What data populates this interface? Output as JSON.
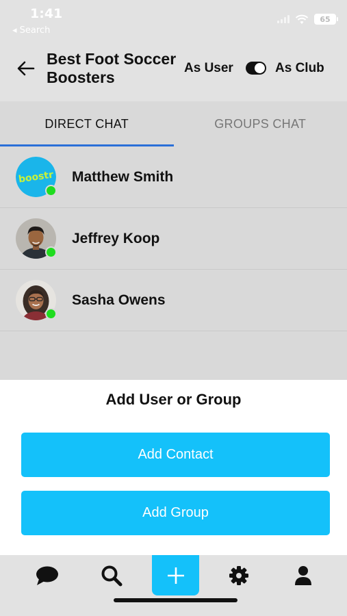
{
  "status_bar": {
    "time": "1:41",
    "back_app": "◂ Search",
    "battery": "65"
  },
  "header": {
    "title": "Best Foot Soccer Boosters",
    "toggle_left_label": "As User",
    "toggle_right_label": "As Club",
    "toggle_state": "club"
  },
  "tabs": [
    {
      "label": "DIRECT CHAT",
      "active": true
    },
    {
      "label": "GROUPS CHAT",
      "active": false
    }
  ],
  "chats": [
    {
      "name": "Matthew Smith",
      "avatar": "boostr-logo",
      "online": true
    },
    {
      "name": "Jeffrey Koop",
      "avatar": "person-photo",
      "online": true
    },
    {
      "name": "Sasha Owens",
      "avatar": "person-photo",
      "online": true
    }
  ],
  "sheet": {
    "title": "Add User or Group",
    "add_contact": "Add Contact",
    "add_group": "Add Group"
  },
  "nav": {
    "items": [
      "chat-icon",
      "search-icon",
      "plus-icon",
      "gear-icon",
      "profile-icon"
    ],
    "active": "plus-icon"
  },
  "colors": {
    "accent": "#14c1fa",
    "tab_underline": "#2a6fd8",
    "online": "#1fdc1f"
  }
}
